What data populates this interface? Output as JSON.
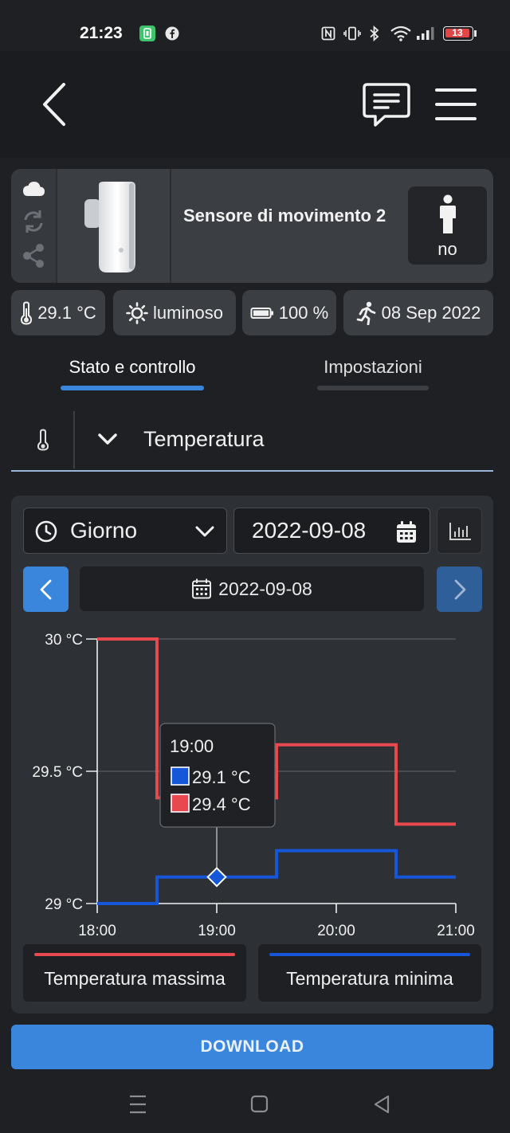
{
  "status_bar": {
    "time": "21:23",
    "battery_level": "13"
  },
  "device": {
    "name": "Sensore di movimento 2",
    "motion_state": "no"
  },
  "chips": {
    "temperature": "29.1 °C",
    "light": "luminoso",
    "battery": "100 %",
    "last_motion": "08 Sep 2022"
  },
  "tabs": [
    {
      "label": "Stato e controllo",
      "active": true
    },
    {
      "label": "Impostazioni",
      "active": false
    }
  ],
  "sensor_select": {
    "label": "Temperatura"
  },
  "controls": {
    "period": "Giorno",
    "date_input": "2022-09-08",
    "current_date": "2022-09-08"
  },
  "colors": {
    "accent": "#3b86dd",
    "series_max": "#e8494f",
    "series_min": "#1656d9"
  },
  "chart_data": {
    "type": "line",
    "step": true,
    "x_ticks": [
      "18:00",
      "19:00",
      "20:00",
      "21:00"
    ],
    "y_ticks": [
      "29 °C",
      "29.5 °C",
      "30 °C"
    ],
    "ylim": [
      29,
      30
    ],
    "series": [
      {
        "name": "Temperatura massima",
        "points": [
          [
            "18:00",
            30
          ],
          [
            "18:30",
            30
          ],
          [
            "18:30",
            29.4
          ],
          [
            "19:30",
            29.4
          ],
          [
            "19:30",
            29.6
          ],
          [
            "20:30",
            29.6
          ],
          [
            "20:30",
            29.3
          ],
          [
            "21:00",
            29.3
          ]
        ]
      },
      {
        "name": "Temperatura minima",
        "points": [
          [
            "18:00",
            29
          ],
          [
            "18:30",
            29
          ],
          [
            "18:30",
            29.1
          ],
          [
            "19:30",
            29.1
          ],
          [
            "19:30",
            29.2
          ],
          [
            "20:30",
            29.2
          ],
          [
            "20:30",
            29.1
          ],
          [
            "21:00",
            29.1
          ]
        ]
      }
    ],
    "tooltip": {
      "time": "19:00",
      "min_value": "29.1 °C",
      "max_value": "29.4 °C"
    },
    "grid": true,
    "legend": "bottom"
  },
  "download_label": "DOWNLOAD"
}
